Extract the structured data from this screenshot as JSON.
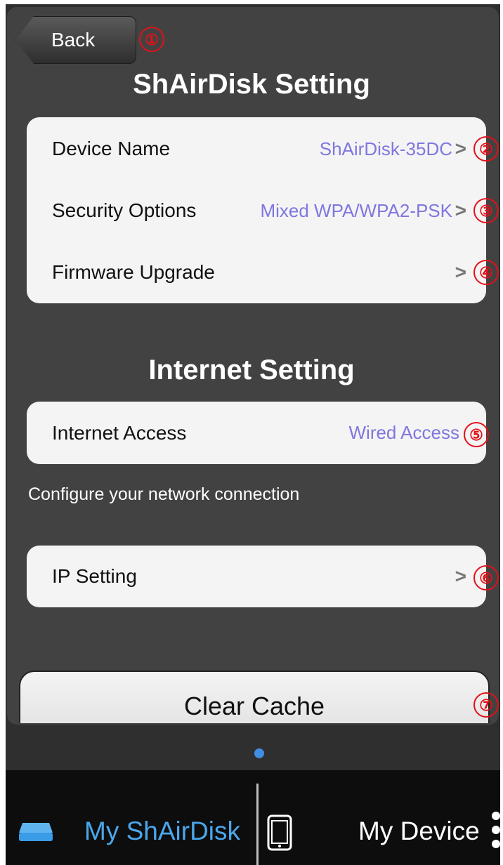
{
  "header": {
    "back_label": "Back",
    "title": "ShAirDisk Setting"
  },
  "settings": {
    "rows": [
      {
        "label": "Device Name",
        "value": "ShAirDisk-35DC"
      },
      {
        "label": "Security Options",
        "value": "Mixed WPA/WPA2-PSK"
      },
      {
        "label": "Firmware Upgrade",
        "value": ""
      }
    ]
  },
  "internet": {
    "title": "Internet Setting",
    "access_label": "Internet Access",
    "access_value": "Wired Access",
    "helper": "Configure your network connection",
    "ip_label": "IP Setting"
  },
  "actions": {
    "clear_cache": "Clear Cache"
  },
  "markers": [
    "①",
    "②",
    "③",
    "④",
    "⑤",
    "⑥",
    "⑦"
  ],
  "tabbar": {
    "left_label": "My ShAirDisk",
    "right_label": "My Device",
    "left_icon": "hard-drive-icon",
    "right_icon": "phone-icon",
    "more_icon": "more-dots-icon"
  },
  "colors": {
    "accent_blue": "#4ba7ec",
    "value_purple": "#7f77df",
    "marker_red": "#e3101a",
    "page_indicator": "#3f8ee4"
  }
}
